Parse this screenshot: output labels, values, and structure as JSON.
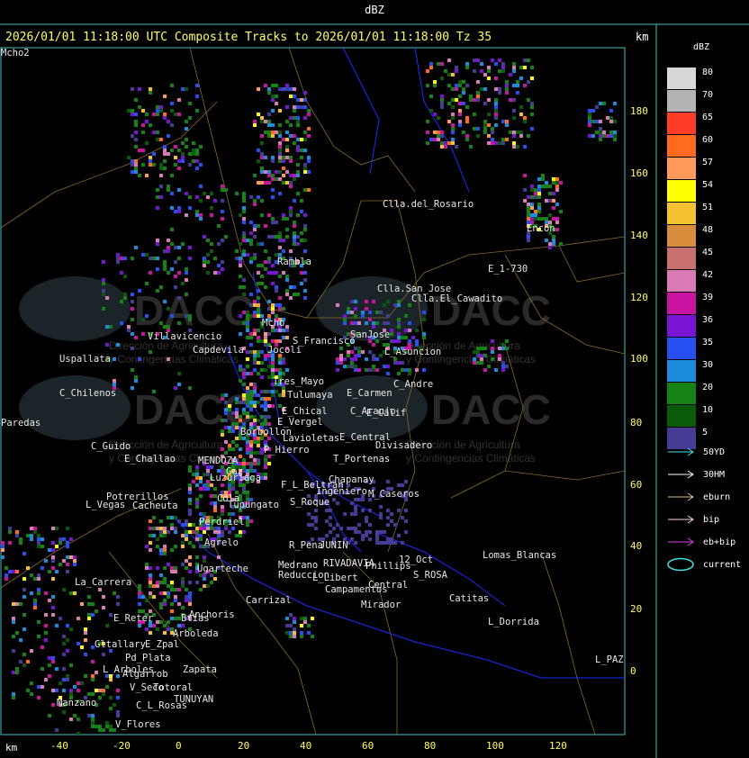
{
  "top_title": "dBZ",
  "header": "2026/01/01 11:18:00 UTC Composite Tracks to 2026/01/01 11:18:00 Tz 35",
  "km_label": "km",
  "legend": {
    "title": "dBZ",
    "levels": [
      {
        "label": "80",
        "color": "#d8d8d8"
      },
      {
        "label": "70",
        "color": "#b4b4b4"
      },
      {
        "label": "65",
        "color": "#ff3c28"
      },
      {
        "label": "60",
        "color": "#ff6a1e"
      },
      {
        "label": "57",
        "color": "#ff9a5a"
      },
      {
        "label": "54",
        "color": "#ffff00"
      },
      {
        "label": "51",
        "color": "#f5c032"
      },
      {
        "label": "48",
        "color": "#d88c3c"
      },
      {
        "label": "45",
        "color": "#c87070"
      },
      {
        "label": "42",
        "color": "#d87ab4"
      },
      {
        "label": "39",
        "color": "#c814a0"
      },
      {
        "label": "36",
        "color": "#7814d2"
      },
      {
        "label": "35",
        "color": "#2850f0"
      },
      {
        "label": "30",
        "color": "#1e8cdc"
      },
      {
        "label": "20",
        "color": "#148214"
      },
      {
        "label": "10",
        "color": "#0a5a0a"
      },
      {
        "label": "5",
        "color": "#463c96"
      }
    ],
    "tracks": [
      {
        "label": "50YD",
        "color": "#40e0e0"
      },
      {
        "label": "30HM",
        "color": "#ffffff"
      },
      {
        "label": "eburn",
        "color": "#e0c080"
      },
      {
        "label": "bip",
        "color": "#ffd0e0"
      },
      {
        "label": "eb+bip",
        "color": "#e040e0"
      },
      {
        "label": "current",
        "color": "#40e0e0"
      }
    ]
  },
  "y_ticks": [
    "180",
    "160",
    "140",
    "120",
    "100",
    "80",
    "60",
    "40",
    "20",
    "0"
  ],
  "x_ticks": [
    "-40",
    "-20",
    "0",
    "20",
    "40",
    "60",
    "80",
    "100",
    "120"
  ],
  "watermark": {
    "brand": "DACC",
    "line1": "Dirección de Agricultura",
    "line2": "y Contingencias Climáticas"
  },
  "places": [
    "Clla.del_Rosario",
    "Rambla",
    "E_1-730",
    "Clla.San_Jose",
    "Clla.El_Cawadito",
    "Villavicencio",
    "S_Francisco",
    "SanJose",
    "L_Asuncion",
    "Uspallata",
    "Capdevila",
    "Jocoli",
    "C_Andre",
    "E_Carmen",
    "C_Chilenos",
    "Tres_Mayo",
    "Tulumaya",
    "C_Araujo",
    "E_Calif",
    "Paredas",
    "E_Chical",
    "E_Vergel",
    "Borbollon",
    "Lavioletas",
    "E_Central",
    "Divisadero",
    "C_Guido",
    "P_Hierro",
    "T_Portenas",
    "E_Challao",
    "MENDOZA",
    "Gaz",
    "Potrerillos",
    "Cacheuta",
    "Luzuriaga",
    "Chapanay",
    "L_Vegas",
    "F_L_Beltran",
    "Ingeniero",
    "M_Caseros",
    "S_Roque",
    "Perdriel",
    "Agrelo",
    "Tupungato",
    "R_Pena",
    "JUNIN",
    "Lomas_Blancas",
    "Ugarteche",
    "Medrano",
    "RIVADAVIA",
    "Phillips",
    "12_Oct",
    "Reduccion",
    "L_Libert",
    "S_ROSA",
    "La_Carrera",
    "Catitas",
    "Carrizal",
    "Campamentos",
    "Central",
    "Anchoris",
    "Mirador",
    "Arboleda",
    "L_Dorrida",
    "Gltallary",
    "E_Zpal",
    "L_PAZ",
    "L_Arboles",
    "Pd_Plata",
    "Zapata",
    "Algarrob",
    "V_Seco",
    "Totoral",
    "TUNUYAN",
    "Manzano",
    "C_L_Rosas",
    "V_Flores",
    "Encon",
    "E_Reter",
    "Btias",
    "Cdla",
    "Mcho",
    "Mcho2"
  ]
}
